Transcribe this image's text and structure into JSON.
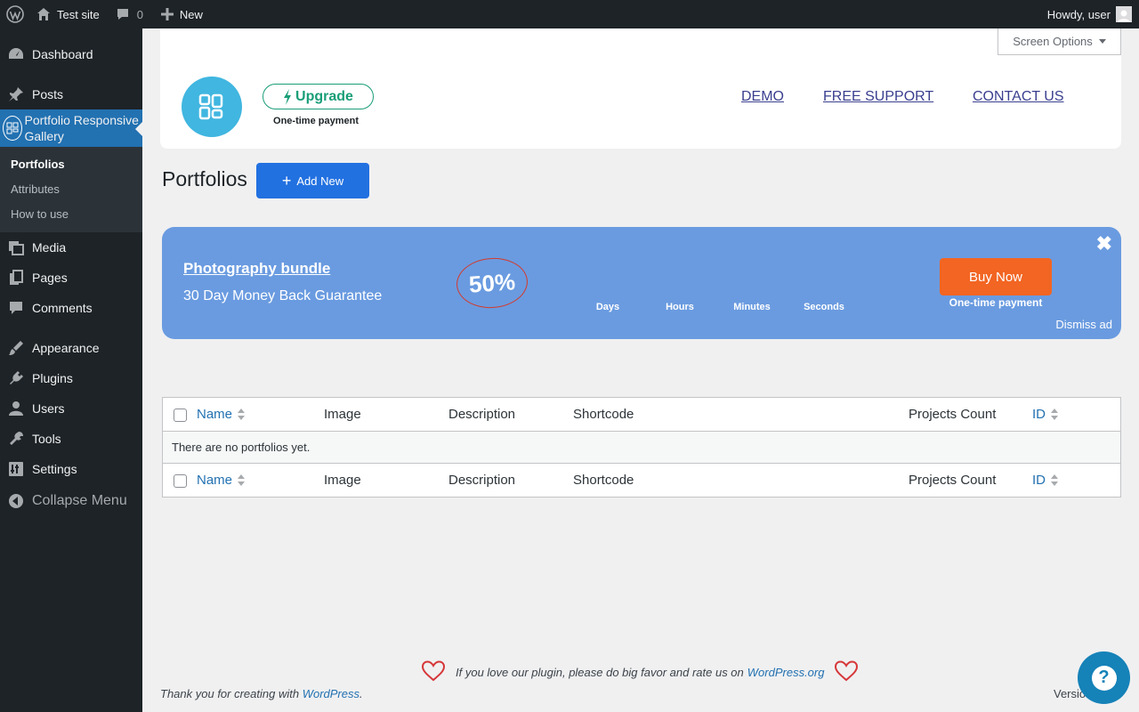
{
  "admin_bar": {
    "site_name": "Test site",
    "comments_count": "0",
    "new_label": "New",
    "howdy": "Howdy, user"
  },
  "sidebar": {
    "items": [
      {
        "label": "Dashboard",
        "icon": "dashboard-icon"
      },
      {
        "label": "Posts",
        "icon": "pin-icon"
      },
      {
        "label": "Portfolio Responsive Gallery",
        "icon": "gallery-icon"
      },
      {
        "label": "Media",
        "icon": "media-icon"
      },
      {
        "label": "Pages",
        "icon": "pages-icon"
      },
      {
        "label": "Comments",
        "icon": "comment-icon"
      },
      {
        "label": "Appearance",
        "icon": "brush-icon"
      },
      {
        "label": "Plugins",
        "icon": "plug-icon"
      },
      {
        "label": "Users",
        "icon": "user-icon"
      },
      {
        "label": "Tools",
        "icon": "wrench-icon"
      },
      {
        "label": "Settings",
        "icon": "settings-icon"
      }
    ],
    "submenu": [
      "Portfolios",
      "Attributes",
      "How to use"
    ],
    "collapse_label": "Collapse Menu"
  },
  "header": {
    "screen_options": "Screen Options",
    "upgrade_label": "Upgrade",
    "upgrade_note": "One-time payment",
    "links": [
      "DEMO",
      "FREE SUPPORT",
      "CONTACT US"
    ]
  },
  "page": {
    "title": "Portfolios",
    "add_new": "Add New"
  },
  "ad": {
    "title": "Photography bundle",
    "subtitle": "30 Day Money Back Guarantee",
    "discount": "50%",
    "countdown": [
      "Days",
      "Hours",
      "Minutes",
      "Seconds"
    ],
    "buy_label": "Buy Now",
    "buy_note": "One-time payment",
    "dismiss": "Dismiss ad",
    "close": "✖"
  },
  "table": {
    "columns": [
      "Name",
      "Image",
      "Description",
      "Shortcode",
      "Projects Count",
      "ID"
    ],
    "empty_message": "There are no portfolios yet."
  },
  "footer": {
    "rate_text": "If you love our plugin, please do big favor and rate us on",
    "rate_link": "WordPress.org",
    "thanks_text": "Thank you for creating with",
    "thanks_link": "WordPress",
    "thanks_end": ".",
    "version": "Versio",
    "help": "?"
  },
  "colors": {
    "admin_dark": "#1d2327",
    "accent_blue": "#2271b1",
    "ad_blue": "#6a9be0",
    "buy_orange": "#f26522",
    "upgrade_green": "#1a9e78"
  }
}
